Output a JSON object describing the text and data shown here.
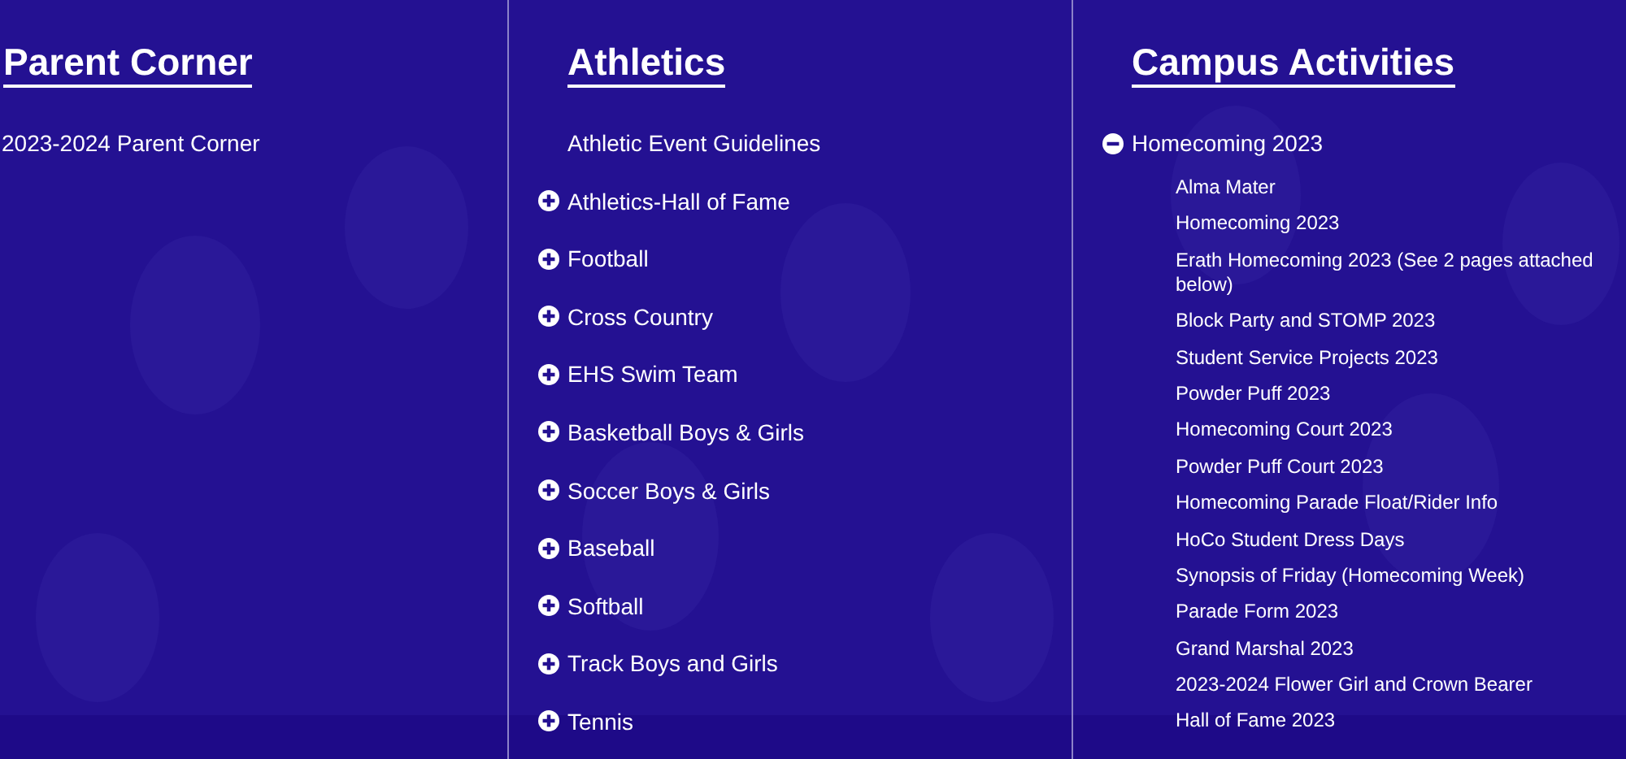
{
  "columns": [
    {
      "title": "Parent Corner",
      "items": [
        {
          "kind": "link",
          "label": "2023-2024 Parent Corner"
        }
      ]
    },
    {
      "title": "Athletics",
      "items": [
        {
          "kind": "link",
          "label": "Athletic Event Guidelines"
        },
        {
          "kind": "folder",
          "label": "Athletics-Hall of Fame",
          "expanded": false
        },
        {
          "kind": "folder",
          "label": "Football",
          "expanded": false
        },
        {
          "kind": "folder",
          "label": "Cross Country",
          "expanded": false
        },
        {
          "kind": "folder",
          "label": "EHS Swim Team",
          "expanded": false
        },
        {
          "kind": "folder",
          "label": "Basketball Boys & Girls",
          "expanded": false
        },
        {
          "kind": "folder",
          "label": "Soccer Boys & Girls",
          "expanded": false
        },
        {
          "kind": "folder",
          "label": "Baseball",
          "expanded": false
        },
        {
          "kind": "folder",
          "label": "Softball",
          "expanded": false
        },
        {
          "kind": "folder",
          "label": "Track Boys and Girls",
          "expanded": false
        },
        {
          "kind": "folder",
          "label": "Tennis",
          "expanded": false
        }
      ]
    },
    {
      "title": "Campus Activities",
      "items": [
        {
          "kind": "folder",
          "label": "Homecoming 2023",
          "expanded": true,
          "children": [
            "Alma Mater",
            "Homecoming 2023",
            "Erath Homecoming 2023 (See 2 pages attached below)",
            "Block Party and STOMP 2023",
            "Student Service Projects 2023",
            "Powder Puff 2023",
            "Homecoming Court 2023",
            "Powder Puff Court 2023",
            "Homecoming Parade Float/Rider Info",
            "HoCo Student Dress Days",
            "Synopsis of Friday (Homecoming Week)",
            "Parade Form 2023",
            "Grand Marshal 2023",
            "2023-2024 Flower Girl and Crown Bearer",
            "Hall of Fame 2023"
          ]
        }
      ]
    }
  ]
}
